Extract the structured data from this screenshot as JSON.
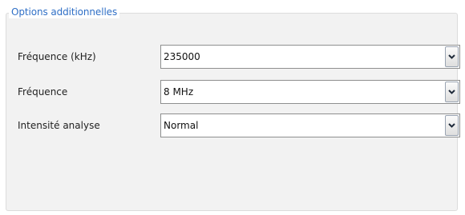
{
  "groupbox": {
    "title": "Options additionnelles"
  },
  "rows": [
    {
      "label": "Fréquence (kHz)",
      "value": "235000"
    },
    {
      "label": "Fréquence",
      "value": "8 MHz"
    },
    {
      "label": "Intensité analyse",
      "value": "Normal"
    }
  ],
  "icons": {
    "dropdown": "chevron-down-icon"
  }
}
